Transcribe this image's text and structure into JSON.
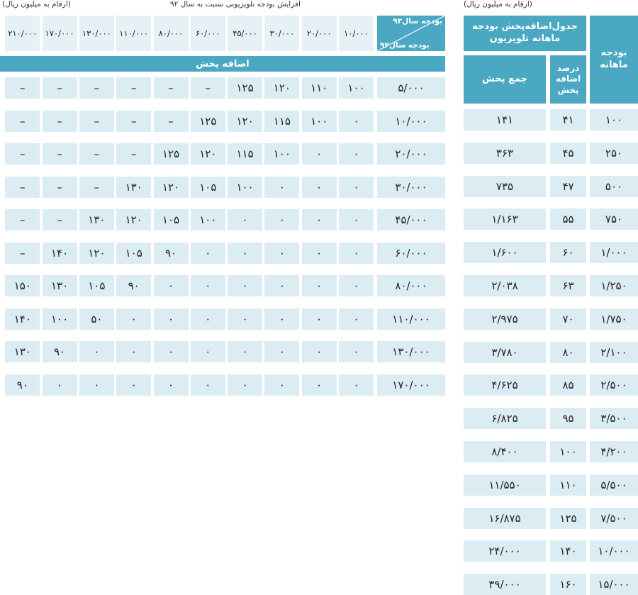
{
  "left": {
    "units_note": "(ارقام به میلیون ریال)",
    "title": "افزایش بودجه تلویزیونی نسبت به سال ۹۲",
    "corner_top": "بودجه سال۹۳",
    "corner_bottom": "بودجه سال۹۲",
    "band_label": "اضافه پخش",
    "col_headers": [
      "۱۰/۰۰۰",
      "۲۰/۰۰۰",
      "۳۰/۰۰۰",
      "۴۵/۰۰۰",
      "۶۰/۰۰۰",
      "۸۰/۰۰۰",
      "۱۱۰/۰۰۰",
      "۱۳۰/۰۰۰",
      "۱۷۰/۰۰۰",
      "۲۱۰/۰۰۰"
    ],
    "rows": [
      {
        "budget": "۵/۰۰۰",
        "values": [
          "۱۰۰",
          "۱۱۰",
          "۱۲۰",
          "۱۲۵",
          "–",
          "–",
          "–",
          "–",
          "–",
          "–"
        ]
      },
      {
        "budget": "۱۰/۰۰۰",
        "values": [
          "۰",
          "۱۰۰",
          "۱۱۵",
          "۱۲۰",
          "۱۲۵",
          "–",
          "–",
          "–",
          "–",
          "–"
        ]
      },
      {
        "budget": "۲۰/۰۰۰",
        "values": [
          "۰",
          "۰",
          "۱۰۰",
          "۱۱۵",
          "۱۲۰",
          "۱۲۵",
          "–",
          "–",
          "–",
          "–"
        ]
      },
      {
        "budget": "۳۰/۰۰۰",
        "values": [
          "۰",
          "۰",
          "۰",
          "۱۰۰",
          "۱۰۵",
          "۱۲۰",
          "۱۳۰",
          "–",
          "–",
          "–"
        ]
      },
      {
        "budget": "۴۵/۰۰۰",
        "values": [
          "۰",
          "۰",
          "۰",
          "۰",
          "۱۰۰",
          "۱۰۵",
          "۱۲۰",
          "۱۳۰",
          "–",
          "–"
        ]
      },
      {
        "budget": "۶۰/۰۰۰",
        "values": [
          "۰",
          "۰",
          "۰",
          "۰",
          "۰",
          "۹۰",
          "۱۰۵",
          "۱۲۰",
          "۱۴۰",
          "–"
        ]
      },
      {
        "budget": "۸۰/۰۰۰",
        "values": [
          "۰",
          "۰",
          "۰",
          "۰",
          "۰",
          "۰",
          "۹۰",
          "۱۰۵",
          "۱۳۰",
          "۱۵۰"
        ]
      },
      {
        "budget": "۱۱۰/۰۰۰",
        "values": [
          "۰",
          "۰",
          "۰",
          "۰",
          "۰",
          "۰",
          "۰",
          "۵۰",
          "۱۰۰",
          "۱۴۰"
        ]
      },
      {
        "budget": "۱۳۰/۰۰۰",
        "values": [
          "۰",
          "۰",
          "۰",
          "۰",
          "۰",
          "۰",
          "۰",
          "۰",
          "۹۰",
          "۱۳۰"
        ]
      },
      {
        "budget": "۱۷۰/۰۰۰",
        "values": [
          "۰",
          "۰",
          "۰",
          "۰",
          "۰",
          "۰",
          "۰",
          "۰",
          "۰",
          "۹۰"
        ]
      }
    ]
  },
  "right": {
    "units_note": "(ارقام به میلیون ریال)",
    "title": "جدول‌اضافه‌پخش بودجه ماهانه تلویزیون",
    "header_budget": "بودجه ماهانه",
    "header_percent": "درصد اضافه پخش",
    "header_total": "جمع پخش",
    "rows": [
      {
        "budget": "۱۰۰",
        "percent": "۴۱",
        "total": "۱۴۱"
      },
      {
        "budget": "۲۵۰",
        "percent": "۴۵",
        "total": "۳۶۳"
      },
      {
        "budget": "۵۰۰",
        "percent": "۴۷",
        "total": "۷۳۵"
      },
      {
        "budget": "۷۵۰",
        "percent": "۵۵",
        "total": "۱/۱۶۳"
      },
      {
        "budget": "۱/۰۰۰",
        "percent": "۶۰",
        "total": "۱/۶۰۰"
      },
      {
        "budget": "۱/۲۵۰",
        "percent": "۶۳",
        "total": "۲/۰۳۸"
      },
      {
        "budget": "۱/۷۵۰",
        "percent": "۷۰",
        "total": "۲/۹۷۵"
      },
      {
        "budget": "۲/۱۰۰",
        "percent": "۸۰",
        "total": "۳/۷۸۰"
      },
      {
        "budget": "۲/۵۰۰",
        "percent": "۸۵",
        "total": "۴/۶۲۵"
      },
      {
        "budget": "۳/۵۰۰",
        "percent": "۹۵",
        "total": "۶/۸۲۵"
      },
      {
        "budget": "۴/۲۰۰",
        "percent": "۱۰۰",
        "total": "۸/۴۰۰"
      },
      {
        "budget": "۵/۵۰۰",
        "percent": "۱۱۰",
        "total": "۱۱/۵۵۰"
      },
      {
        "budget": "۷/۵۰۰",
        "percent": "۱۲۵",
        "total": "۱۶/۸۷۵"
      },
      {
        "budget": "۱۰/۰۰۰",
        "percent": "۱۴۰",
        "total": "۲۴/۰۰۰"
      },
      {
        "budget": "۱۵/۰۰۰",
        "percent": "۱۶۰",
        "total": "۳۹/۰۰۰"
      }
    ]
  },
  "colors": {
    "accent": "#4aa8c3",
    "cell": "#dcecf3",
    "header_cell": "#e6f1f6"
  }
}
